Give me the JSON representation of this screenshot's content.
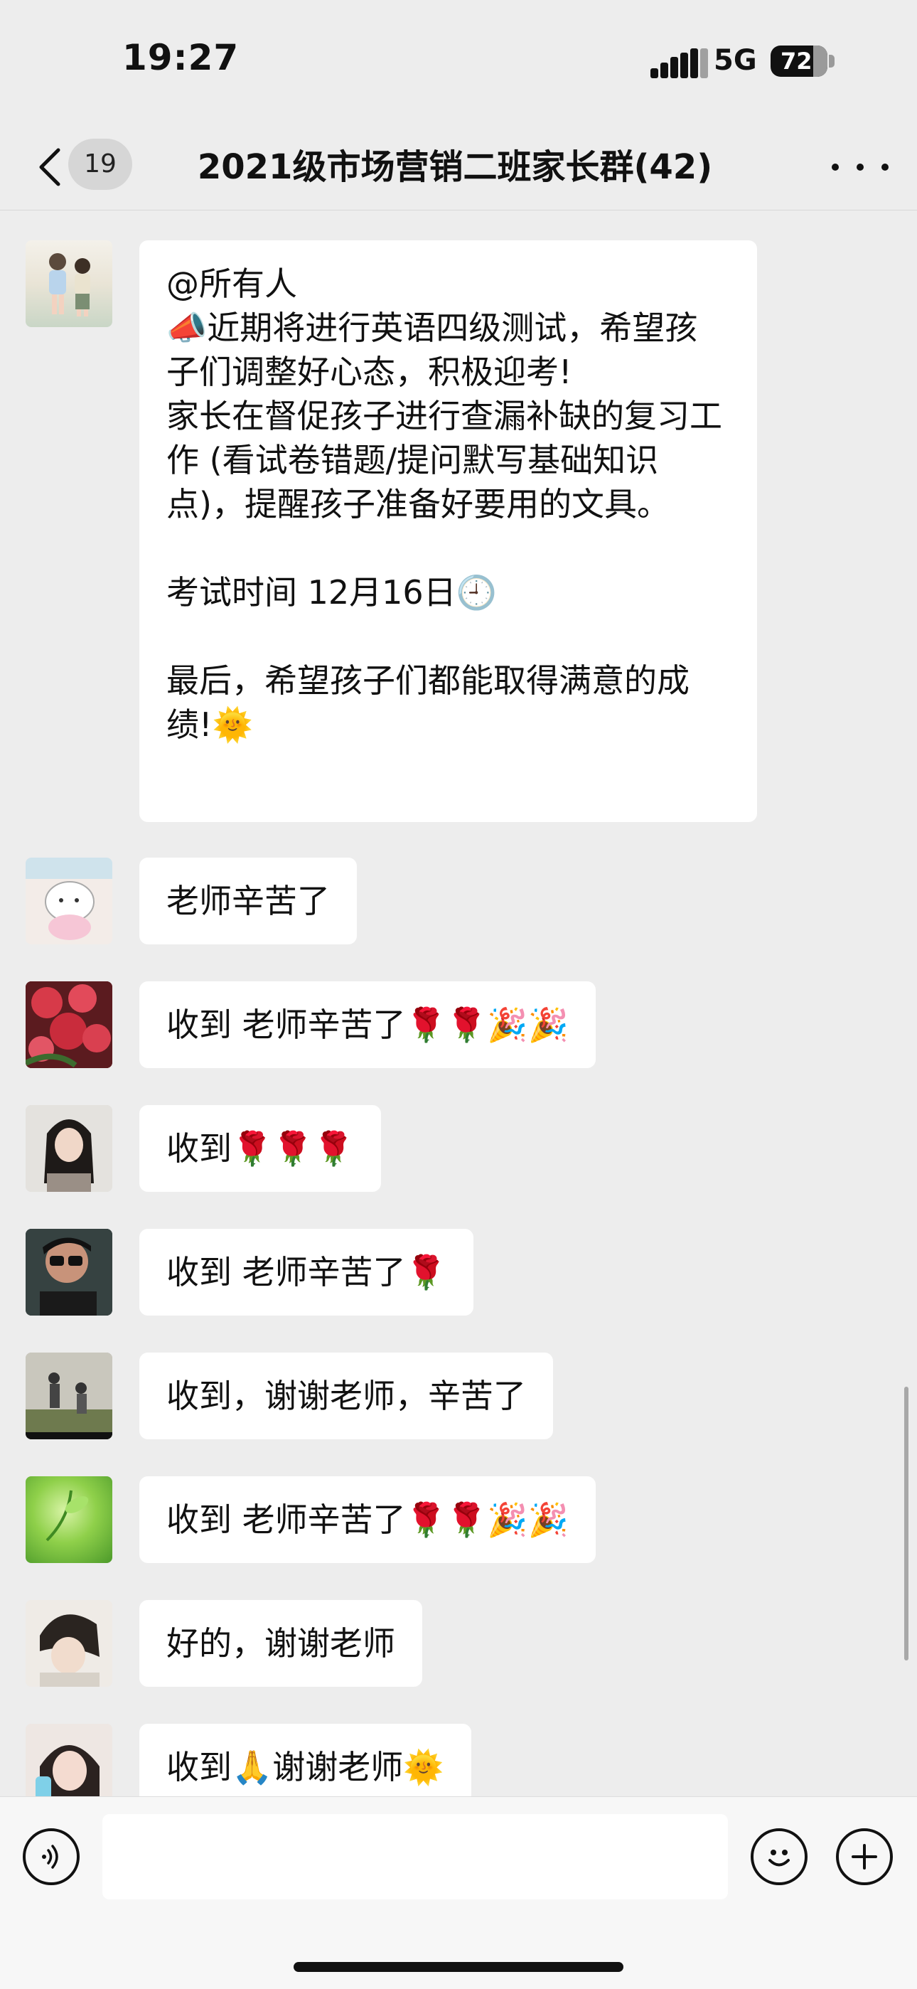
{
  "status_bar": {
    "time": "19:27",
    "network": "5G",
    "battery": "72"
  },
  "nav": {
    "unread_count": "19",
    "title": "2021级市场营销二班家长群(42)"
  },
  "messages": [
    {
      "text": "@所有人\n📣近期将进行英语四级测试，希望孩子们调整好心态，积极迎考!\n家长在督促孩子进行查漏补缺的复习工作 (看试卷错题/提问默写基础知识点)，提醒孩子准备好要用的文具。\n\n考试时间 12月16日🕘\n\n最后，希望孩子们都能取得满意的成绩!🌞"
    },
    {
      "text": "老师辛苦了"
    },
    {
      "text": "收到 老师辛苦了🌹🌹🎉🎉"
    },
    {
      "text": "收到🌹🌹🌹"
    },
    {
      "text": "收到 老师辛苦了🌹"
    },
    {
      "text": "收到，谢谢老师，辛苦了"
    },
    {
      "text": "收到 老师辛苦了🌹🌹🎉🎉"
    },
    {
      "text": "好的，谢谢老师"
    },
    {
      "text": "收到🙏谢谢老师🌞"
    }
  ],
  "colors": {
    "background": "#ededed",
    "bubble": "#ffffff",
    "input_bar": "#f7f7f7"
  },
  "icons": [
    "back-chevron-icon",
    "more-dots-icon",
    "voice-icon",
    "emoji-icon",
    "plus-icon"
  ]
}
